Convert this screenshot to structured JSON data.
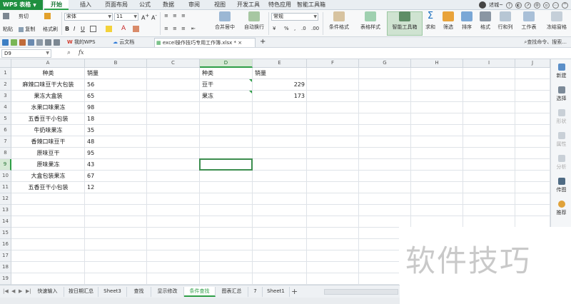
{
  "app": {
    "brand": "WPS 表格"
  },
  "menu": [
    "开始",
    "插入",
    "页面布局",
    "公式",
    "数据",
    "审阅",
    "视图",
    "开发工具",
    "特色应用",
    "智能工具箱"
  ],
  "menu_active_index": 0,
  "user": {
    "name": "述城~"
  },
  "ribbon": {
    "paste": "粘贴",
    "cut": "剪切",
    "copy": "复制",
    "format_painter": "格式刷",
    "font_name": "宋体",
    "font_size": "11",
    "merge_center": "合并居中",
    "wrap_text": "自动换行",
    "number_format": "常规",
    "conditional_format": "条件格式",
    "table_style": "表格样式",
    "smart_toolbox": "智能工具箱",
    "sum": "求和",
    "filter": "筛选",
    "sort": "排序",
    "format": "格式",
    "rows_cols": "行和列",
    "worksheet": "工作表",
    "freeze": "冻结窗格"
  },
  "file_tabs": [
    {
      "label": "我的WPS"
    },
    {
      "label": "云文档"
    },
    {
      "label": "excel操作技巧专用工作簿.xlsx *",
      "active": true
    }
  ],
  "find_command": "查找命令、搜索...",
  "formula_bar": {
    "name_box": "D9",
    "formula": ""
  },
  "columns": [
    "A",
    "B",
    "C",
    "D",
    "E",
    "F",
    "G",
    "H",
    "I",
    "J"
  ],
  "selected_column": "D",
  "selected_row": 9,
  "rows": [
    1,
    2,
    3,
    4,
    5,
    6,
    7,
    8,
    9,
    10,
    11,
    12,
    13,
    14,
    15,
    16,
    17,
    18,
    19
  ],
  "table_left": {
    "header": [
      "种类",
      "销量"
    ],
    "data": [
      [
        "麻辣口味豆干大包装",
        "56"
      ],
      [
        "果冻大盒装",
        "65"
      ],
      [
        "水果口味果冻",
        "98"
      ],
      [
        "五香豆干小包装",
        "18"
      ],
      [
        "牛奶味果冻",
        "35"
      ],
      [
        "香辣口味豆干",
        "48"
      ],
      [
        "原味豆干",
        "95"
      ],
      [
        "原味果冻",
        "43"
      ],
      [
        "大盒包装果冻",
        "67"
      ],
      [
        "五香豆干小包装",
        "12"
      ]
    ]
  },
  "table_right": {
    "header": [
      "种类",
      "销量"
    ],
    "data": [
      [
        "豆干",
        "229"
      ],
      [
        "果冻",
        "173"
      ]
    ]
  },
  "sheet_tabs": [
    "快速输入",
    "按日期汇总",
    "Sheet3",
    "查找",
    "显示修改",
    "条件查找",
    "图表汇总",
    "7",
    "Sheet1"
  ],
  "active_sheet": "条件查找",
  "task_pane": [
    "新建",
    "选择",
    "形状",
    "属性",
    "分析",
    "传图",
    "推荐"
  ],
  "watermark": "软件技巧",
  "colors": {
    "accent": "#2e9e46",
    "brand_bg": "#1f8f3f"
  }
}
